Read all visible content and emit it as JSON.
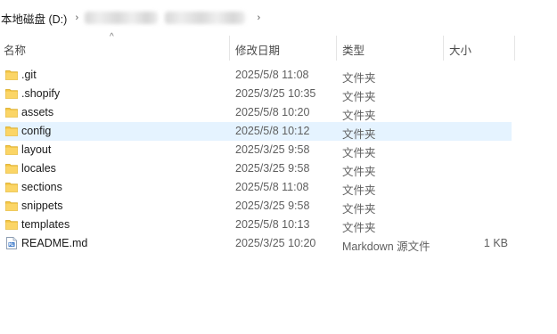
{
  "breadcrumb": {
    "drive_label": "本地磁盘 (D:)",
    "sep": "›"
  },
  "columns": {
    "name": "名称",
    "modified": "修改日期",
    "type": "类型",
    "size": "大小",
    "sort_indicator": "^"
  },
  "files": [
    {
      "name": ".git",
      "modified": "2025/5/8 11:08",
      "type": "文件夹",
      "size": "",
      "icon": "folder-icon"
    },
    {
      "name": ".shopify",
      "modified": "2025/3/25 10:35",
      "type": "文件夹",
      "size": "",
      "icon": "folder-icon"
    },
    {
      "name": "assets",
      "modified": "2025/5/8 10:20",
      "type": "文件夹",
      "size": "",
      "icon": "folder-icon"
    },
    {
      "name": "config",
      "modified": "2025/5/8 10:12",
      "type": "文件夹",
      "size": "",
      "icon": "folder-icon",
      "selected": true
    },
    {
      "name": "layout",
      "modified": "2025/3/25 9:58",
      "type": "文件夹",
      "size": "",
      "icon": "folder-icon"
    },
    {
      "name": "locales",
      "modified": "2025/3/25 9:58",
      "type": "文件夹",
      "size": "",
      "icon": "folder-icon"
    },
    {
      "name": "sections",
      "modified": "2025/5/8 11:08",
      "type": "文件夹",
      "size": "",
      "icon": "folder-icon"
    },
    {
      "name": "snippets",
      "modified": "2025/3/25 9:58",
      "type": "文件夹",
      "size": "",
      "icon": "folder-icon"
    },
    {
      "name": "templates",
      "modified": "2025/5/8 10:13",
      "type": "文件夹",
      "size": "",
      "icon": "folder-icon"
    },
    {
      "name": "README.md",
      "modified": "2025/3/25 10:20",
      "type": "Markdown 源文件",
      "size": "1 KB",
      "icon": "markdown-file-icon"
    }
  ],
  "colors": {
    "folder": "#f5c542",
    "selection": "#e5f3ff"
  }
}
